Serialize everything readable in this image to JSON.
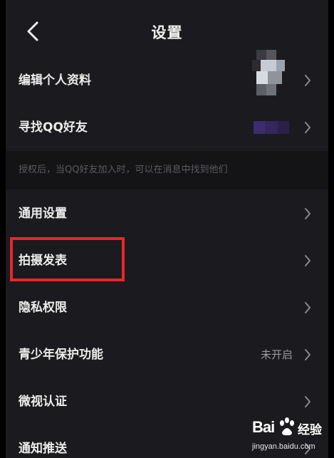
{
  "header": {
    "title": "设置"
  },
  "settings": {
    "edit_profile": "编辑个人资料",
    "find_qq_friends": "寻找QQ好友",
    "qq_notice": "授权后，当QQ好友加入时，可以在消息中找到他们",
    "general": "通用设置",
    "shoot_publish": "拍摄发表",
    "privacy": "隐私权限",
    "teen_mode": "青少年保护功能",
    "teen_mode_value": "未开启",
    "certification": "微视认证",
    "notifications": "通知推送"
  },
  "colors": {
    "background": "#1b1b1f",
    "highlight_border": "#e8262a"
  },
  "watermark": {
    "bai": "Bai",
    "jingyan": "经验",
    "url": "jingyan.baidu.com"
  }
}
